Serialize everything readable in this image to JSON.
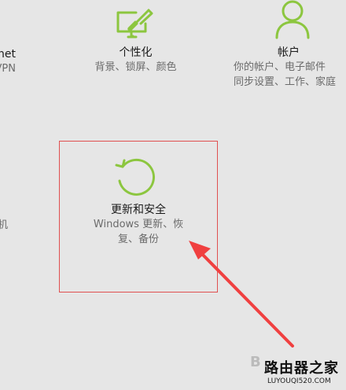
{
  "tiles": {
    "network": {
      "title_fragment": "rnet",
      "desc_fragment": "、VPN"
    },
    "personalization": {
      "title": "个性化",
      "desc": "背景、锁屏、颜色",
      "icon": "personalization-monitor-brush-icon"
    },
    "accounts": {
      "title": "帐户",
      "desc_line1": "你的帐户、电子邮件",
      "desc_line2": "同步设置、工作、家庭",
      "icon": "person-icon"
    },
    "update_security": {
      "title": "更新和安全",
      "desc_line1": "Windows 更新、恢",
      "desc_line2": "复、备份",
      "icon": "refresh-icon"
    },
    "left_lower": {
      "desc_fragment": "机"
    }
  },
  "watermark": {
    "b_fragment": "B",
    "main": "路由器之家",
    "sub": "LUYOUQI520.COM"
  },
  "colors": {
    "accent": "#8cc63f",
    "background": "#e6e6e6",
    "highlight": "#e05050",
    "arrow": "#f04040"
  }
}
